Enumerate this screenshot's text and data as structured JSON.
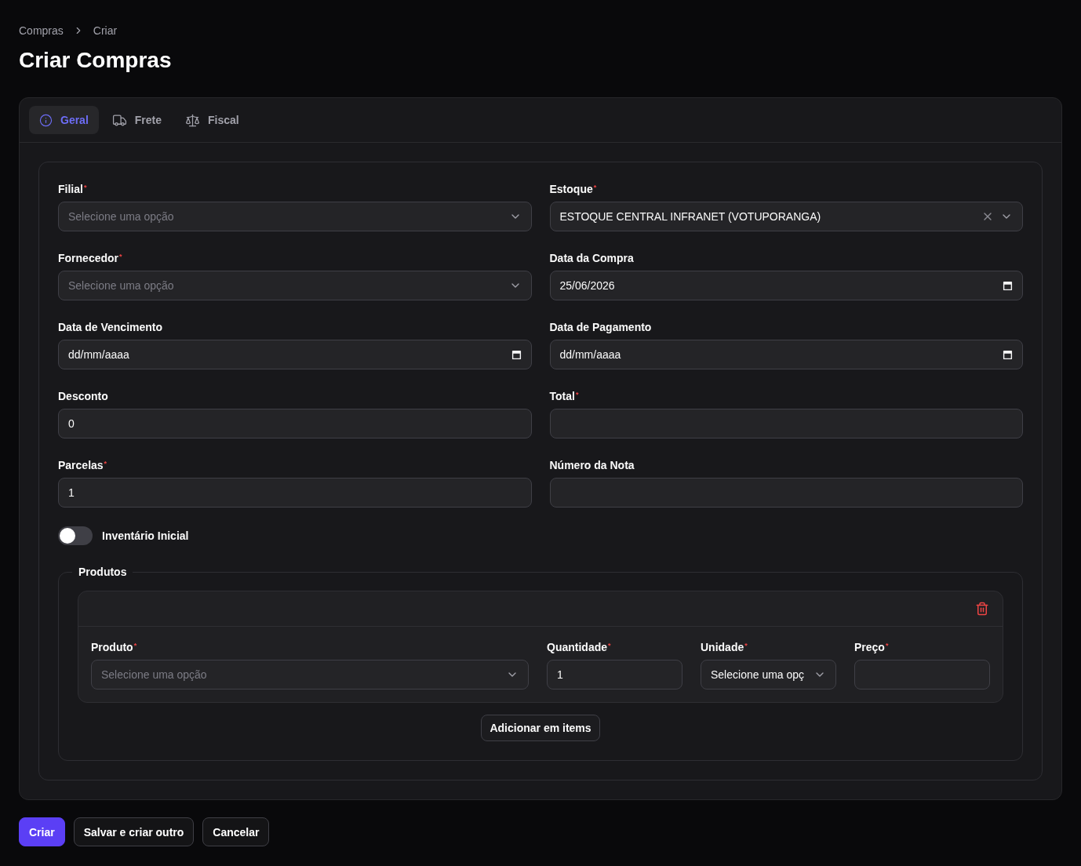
{
  "breadcrumbs": [
    {
      "label": "Compras"
    },
    {
      "label": "Criar"
    }
  ],
  "page_title": "Criar Compras",
  "tabs": [
    {
      "label": "Geral",
      "selected": true
    },
    {
      "label": "Frete",
      "selected": false
    },
    {
      "label": "Fiscal",
      "selected": false
    }
  ],
  "fields": [
    {
      "kind": "select",
      "label": "Filial$^{*}$",
      "placeholder": "Selecione uma opção"
    },
    {
      "kind": "select",
      "label": "Estoque$^{*}$",
      "value": "ESTOQUE CENTRAL INFRANET (VOTUPORANGA)",
      "clearable": true
    },
    {
      "kind": "select",
      "label": "Fornecedor$^{*}$",
      "placeholder": "Selecione uma opção"
    },
    {
      "kind": "date",
      "label": "Data da Compra",
      "value": "25/06/2026"
    },
    {
      "kind": "date",
      "label": "Data de Vencimento",
      "placeholder": "dd/mm/aaaa"
    },
    {
      "kind": "date",
      "label": "Data de Pagamento",
      "placeholder": "dd/mm/aaaa"
    },
    {
      "kind": "text",
      "label": "Desconto",
      "value": "0"
    },
    {
      "kind": "text",
      "label": "Total$^{*}$"
    },
    {
      "kind": "text",
      "label": "Parcelas$^{*}$",
      "value": "1"
    },
    {
      "kind": "text",
      "label": "Número da Nota"
    }
  ],
  "toggle": {
    "label": "Inventário Inicial",
    "on": false
  },
  "products": {
    "legend": "Produtos",
    "items": [
      {
        "fields": [
          {
            "kind": "select",
            "label": "Produto$^{*}$",
            "placeholder": "Selecione uma opção"
          },
          {
            "kind": "text",
            "label": "Quantidade$^{*}$",
            "value": "1"
          },
          {
            "kind": "select",
            "label": "Unidade$^{*}$",
            "value": "Selecione uma opç"
          },
          {
            "kind": "text",
            "label": "Preço$^{*}$"
          }
        ]
      }
    ],
    "add_button": "Adicionar em items"
  },
  "actions": [
    {
      "label": "Criar",
      "kind": "primary"
    },
    {
      "label": "Salvar e criar outro",
      "kind": "secondary"
    },
    {
      "label": "Cancelar",
      "kind": "secondary"
    }
  ]
}
